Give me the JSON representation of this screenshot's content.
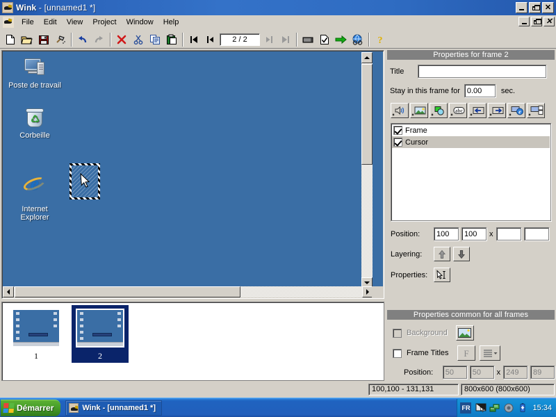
{
  "window": {
    "title_app": "Wink",
    "title_doc": " - [unnamed1 *]",
    "icon": "wink-icon",
    "controls": {
      "minimize": "minimize-icon",
      "restore": "restore-icon",
      "close": "close-icon"
    }
  },
  "menubar": {
    "items": [
      {
        "label": "File"
      },
      {
        "label": "Edit"
      },
      {
        "label": "View"
      },
      {
        "label": "Project"
      },
      {
        "label": "Window"
      },
      {
        "label": "Help"
      }
    ]
  },
  "toolbar": {
    "frame_counter": "2 / 2",
    "buttons": [
      {
        "name": "new-icon",
        "tip": "New"
      },
      {
        "name": "open-icon",
        "tip": "Open"
      },
      {
        "name": "save-icon",
        "tip": "Save"
      },
      {
        "name": "build-icon",
        "tip": "Build"
      },
      {
        "name": "undo-icon",
        "tip": "Undo"
      },
      {
        "name": "redo-icon",
        "tip": "Redo"
      },
      {
        "name": "delete-icon",
        "tip": "Delete"
      },
      {
        "name": "cut-icon",
        "tip": "Cut"
      },
      {
        "name": "copy-icon",
        "tip": "Copy"
      },
      {
        "name": "paste-icon",
        "tip": "Paste"
      },
      {
        "name": "first-frame-icon",
        "tip": "First frame"
      },
      {
        "name": "prev-frame-icon",
        "tip": "Previous frame"
      },
      {
        "name": "next-frame-icon",
        "tip": "Next frame"
      },
      {
        "name": "last-frame-icon",
        "tip": "Last frame"
      },
      {
        "name": "render-icon",
        "tip": "Render"
      },
      {
        "name": "render-preview-icon",
        "tip": "Render and preview"
      },
      {
        "name": "export-icon",
        "tip": "Export"
      },
      {
        "name": "browser-icon",
        "tip": "View in browser"
      },
      {
        "name": "help-icon",
        "tip": "Help"
      }
    ]
  },
  "desktop": {
    "icons": [
      {
        "label": "Poste de travail",
        "glyph": "my-computer-icon"
      },
      {
        "label": "Corbeille",
        "glyph": "recycle-bin-icon"
      },
      {
        "label": "Internet\nExplorer",
        "glyph": "internet-explorer-icon"
      }
    ],
    "selected_object": "cursor-object"
  },
  "filmstrip": {
    "frames": [
      {
        "number": "1",
        "selected": false
      },
      {
        "number": "2",
        "selected": true
      }
    ]
  },
  "frame_properties": {
    "header": "Properties for frame 2",
    "title_label": "Title",
    "title_value": "",
    "stay_label": "Stay in this frame for",
    "stay_value": "0.00",
    "stay_unit": "sec.",
    "add_buttons": [
      {
        "name": "add-sound-icon",
        "tip": "Add sound"
      },
      {
        "name": "add-image-icon",
        "tip": "Add image"
      },
      {
        "name": "add-shape-icon",
        "tip": "Add shape"
      },
      {
        "name": "add-text-icon",
        "tip": "Add text box"
      },
      {
        "name": "add-prev-button-icon",
        "tip": "Add previous button"
      },
      {
        "name": "add-next-button-icon",
        "tip": "Add next button"
      },
      {
        "name": "add-url-button-icon",
        "tip": "Add URL button"
      },
      {
        "name": "add-custom-button-icon",
        "tip": "Add custom button"
      }
    ],
    "objects": [
      {
        "label": "Frame",
        "checked": true,
        "selected": false
      },
      {
        "label": "Cursor",
        "checked": true,
        "selected": true
      }
    ],
    "position_label": "Position:",
    "position_x": "100",
    "position_y": "100",
    "position_sep": "x",
    "position_w": "",
    "position_h": "",
    "layering_label": "Layering:",
    "layer_up": "layer-up-icon",
    "layer_down": "layer-down-icon",
    "properties_label": "Properties:",
    "properties_btn": "cursor-properties-icon"
  },
  "common_properties": {
    "header": "Properties common for all frames",
    "background_label": "Background",
    "background_checked": false,
    "background_btn": "background-image-icon",
    "frame_titles_label": "Frame Titles",
    "frame_titles_checked": false,
    "font_btn": "font-icon",
    "align_btn": "align-icon",
    "position_label": "Position:",
    "position_x": "50",
    "position_y": "50",
    "position_sep": "x",
    "position_w": "249",
    "position_h": "89"
  },
  "statusbar": {
    "selection": "100,100 - 131,131",
    "dimensions": "800x600 (800x600)"
  },
  "taskbar": {
    "start_label": "Démarrer",
    "tasks": [
      {
        "label": "Wink - [unnamed1 *]",
        "icon": "wink-icon"
      }
    ],
    "tray": {
      "language": "FR",
      "icons": [
        {
          "name": "display-settings-icon"
        },
        {
          "name": "network-icon"
        },
        {
          "name": "volume-icon"
        },
        {
          "name": "battery-icon"
        }
      ],
      "clock": "15:34"
    }
  },
  "colors": {
    "desktop_blue": "#3a6ea5",
    "chrome": "#d4d0c8",
    "titlebar_blue": "#2a62b8",
    "selection_navy": "#0a246a",
    "panel_header_gray": "#808080"
  }
}
